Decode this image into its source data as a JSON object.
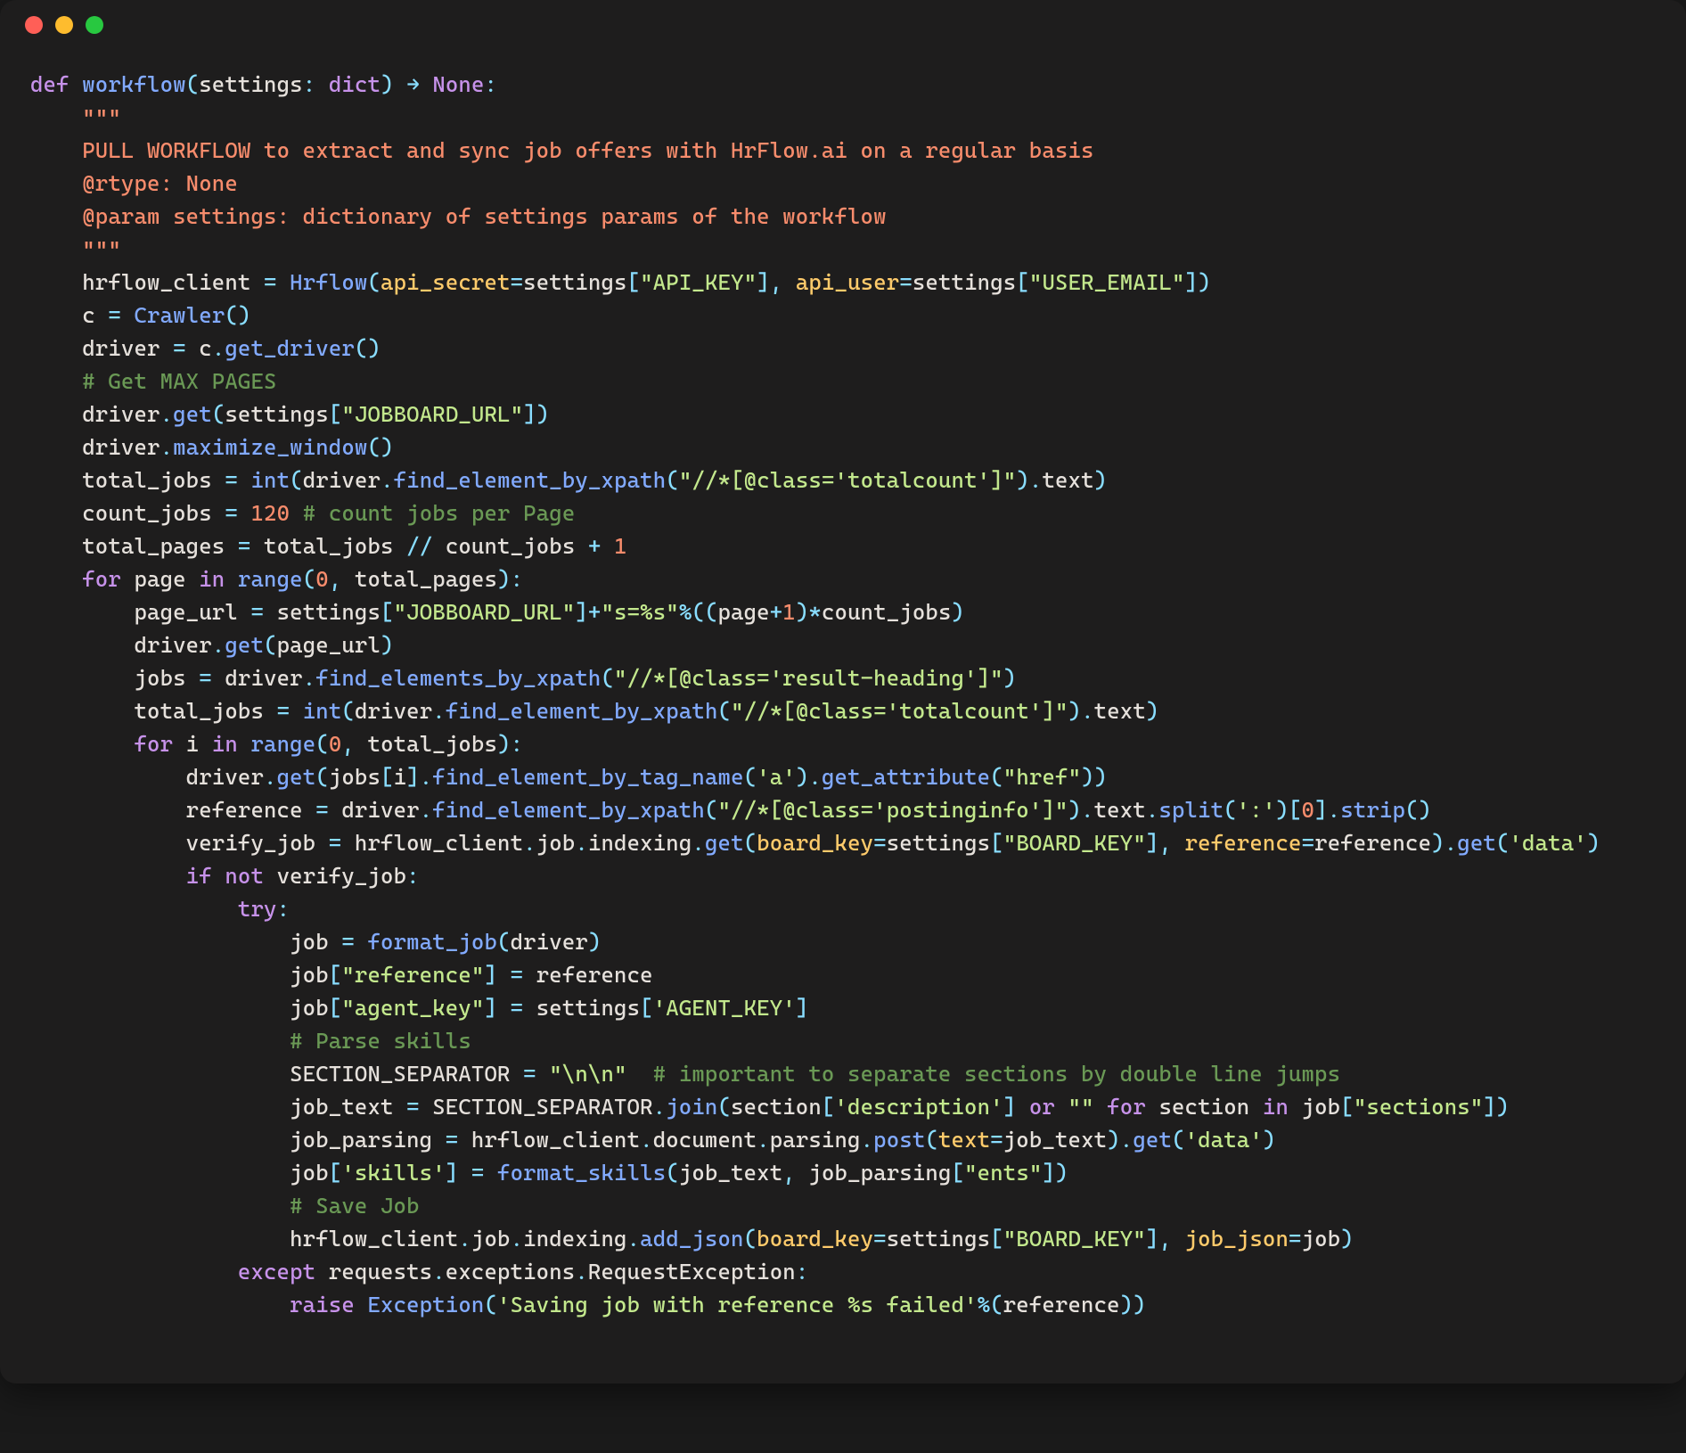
{
  "window": {
    "dots": [
      "close",
      "minimize",
      "zoom"
    ]
  },
  "colors": {
    "bg": "#1e1d1d",
    "fg": "#e6e1dc",
    "keyword": "#c792ea",
    "string": "#c3e88d",
    "docstring": "#f78c6c",
    "number": "#f78c6c",
    "comment": "#6a9955",
    "call": "#82aaff",
    "param": "#ffcb6b",
    "punct": "#89ddff"
  },
  "code_content": {
    "signature": {
      "def": "def",
      "name": "workflow",
      "param_name": "settings",
      "param_type": "dict",
      "arrow": "→",
      "return_type": "None"
    },
    "docstring": {
      "open": "\"\"\"",
      "line1": "PULL WORKFLOW to extract and sync job offers with HrFlow.ai on a regular basis",
      "line2": "@rtype: None",
      "line3": "@param settings: dictionary of settings params of the workflow",
      "close": "\"\"\""
    },
    "lines": {
      "l01": "hrflow_client = Hrflow(api_secret=settings[\"API_KEY\"], api_user=settings[\"USER_EMAIL\"])",
      "l02": "c = Crawler()",
      "l03": "driver = c.get_driver()",
      "c01": "# Get MAX PAGES",
      "l04": "driver.get(settings[\"JOBBOARD_URL\"])",
      "l05": "driver.maximize_window()",
      "l06": "total_jobs = int(driver.find_element_by_xpath(\"//*[@class='totalcount']\").text)",
      "l07a": "count_jobs = 120 ",
      "l07b": "# count jobs per Page",
      "l08": "total_pages = total_jobs // count_jobs + 1",
      "l09": "for page in range(0, total_pages):",
      "l10": "page_url = settings[\"JOBBOARD_URL\"]+\"s=%s\"%((page+1)*count_jobs)",
      "l11": "driver.get(page_url)",
      "l12": "jobs = driver.find_elements_by_xpath(\"//*[@class='result-heading']\")",
      "l13": "total_jobs = int(driver.find_element_by_xpath(\"//*[@class='totalcount']\").text)",
      "l14": "for i in range(0, total_jobs):",
      "l15": "driver.get(jobs[i].find_element_by_tag_name('a').get_attribute(\"href\"))",
      "l16": "reference = driver.find_element_by_xpath(\"//*[@class='postinginfo']\").text.split(':')[0].strip()",
      "l17": "verify_job = hrflow_client.job.indexing.get(board_key=settings[\"BOARD_KEY\"], reference=reference).get('data')",
      "l18": "if not verify_job:",
      "l19": "try:",
      "l20": "job = format_job(driver)",
      "l21": "job[\"reference\"] = reference",
      "l22": "job[\"agent_key\"] = settings['AGENT_KEY']",
      "c02": "# Parse skills",
      "l23a": "SECTION_SEPARATOR = \"\\n\\n\"  ",
      "l23b": "# important to separate sections by double line jumps",
      "l24": "job_text = SECTION_SEPARATOR.join(section['description'] or \"\" for section in job[\"sections\"])",
      "l25": "job_parsing = hrflow_client.document.parsing.post(text=job_text).get('data')",
      "l26": "job['skills'] = format_skills(job_text, job_parsing[\"ents\"])",
      "c03": "# Save Job",
      "l27": "hrflow_client.job.indexing.add_json(board_key=settings[\"BOARD_KEY\"], job_json=job)",
      "l28": "except requests.exceptions.RequestException:",
      "l29": "raise Exception('Saving job with reference %s failed'%(reference))"
    },
    "strings": {
      "API_KEY": "\"API_KEY\"",
      "USER_EMAIL": "\"USER_EMAIL\"",
      "JOBBOARD_URL": "\"JOBBOARD_URL\"",
      "totalcount": "\"//*[@class='totalcount']\"",
      "s_eq": "\"s=%s\"",
      "result_heading": "\"//*[@class='result-heading']\"",
      "a": "'a'",
      "href": "\"href\"",
      "postinginfo": "\"//*[@class='postinginfo']\"",
      "colon": "':'",
      "BOARD_KEY": "\"BOARD_KEY\"",
      "data": "'data'",
      "reference": "\"reference\"",
      "agent_key": "\"agent_key\"",
      "AGENT_KEY": "'AGENT_KEY'",
      "nn": "\"\\n\\n\"",
      "description": "'description'",
      "empty": "\"\"",
      "sections": "\"sections\"",
      "skills": "'skills'",
      "ents": "\"ents\"",
      "save_fail": "'Saving job with reference %s failed'"
    },
    "numbers": {
      "n120": "120",
      "n1": "1",
      "n0": "0"
    }
  }
}
